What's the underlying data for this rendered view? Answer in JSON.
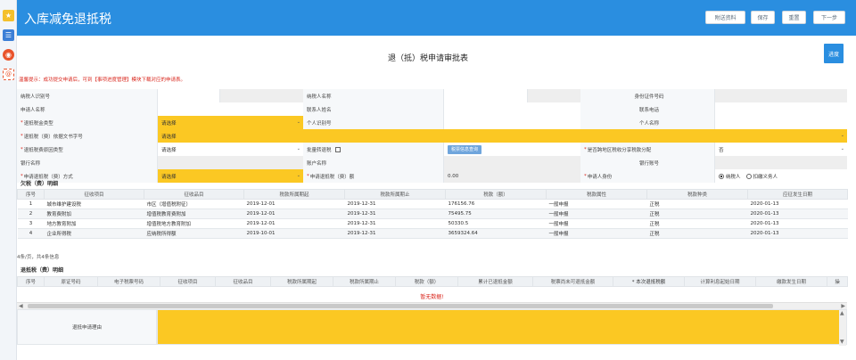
{
  "header": {
    "title": "入库减免退抵税",
    "buttons": {
      "docs": "附送资料",
      "save": "保存",
      "reset": "重置",
      "next": "下一步"
    }
  },
  "progress_button": "进度",
  "page_title": "退（抵）税申请审批表",
  "notice": "温馨提示：成功提交申请后，可到【事项进度管理】模块下载对应的申请表。",
  "form": {
    "row1": {
      "taxpayer_id_label": "纳税人识别号",
      "taxpayer_name_label": "纳税人名称",
      "id_number_label": "身份证件号码"
    },
    "row2": {
      "applicant_label": "申请人名称",
      "contact_label": "联系人姓名",
      "phone_label": "联系电话"
    },
    "row3": {
      "refund_type_label": "退抵税金类型",
      "refund_type_value": "请选择",
      "personal_id_label": "个人识别号",
      "personal_name_label": "个人名称"
    },
    "row4": {
      "doc_no_label": "退抵税（费）依据文书字号",
      "doc_no_value": "请选择"
    },
    "row5": {
      "reason_type_label": "退抵税费原因类型",
      "reason_type_value": "请选择",
      "batch_label": "批量转退税",
      "query_button": "税票信息查询",
      "cross_area_label": "是否跨地区税收分享税款分配",
      "cross_area_value": "否"
    },
    "row6": {
      "bank_name_label": "银行名称",
      "account_name_label": "账户名称",
      "bank_account_label": "银行账号"
    },
    "row7": {
      "method_label": "申请退抵税（费）方式",
      "method_value": "请选择",
      "amount_label": "申请退抵税（费）额",
      "amount_value": "0.00",
      "identity_label": "申请人身份",
      "identity_option_1": "纳税人",
      "identity_option_2": "扣缴义务人"
    }
  },
  "owed_section": {
    "title": "欠税（费）明细",
    "columns": [
      "序号",
      "征收项目",
      "征收品目",
      "税款所属期起",
      "税款所属期止",
      "税款（额）",
      "税款属性",
      "税款种类",
      "应征发生日期"
    ],
    "rows": [
      [
        "1",
        "城市维护建设税",
        "市区（增值税附征）",
        "2019-12-01",
        "2019-12-31",
        "176156.76",
        "一般申报",
        "正税",
        "2020-01-13"
      ],
      [
        "2",
        "教育费附加",
        "增值税教育费附加",
        "2019-12-01",
        "2019-12-31",
        "75495.75",
        "一般申报",
        "正税",
        "2020-01-13"
      ],
      [
        "3",
        "地方教育附加",
        "增值税地方教育附加",
        "2019-12-01",
        "2019-12-31",
        "50330.5",
        "一般申报",
        "正税",
        "2020-01-13"
      ],
      [
        "4",
        "企业所得税",
        "应纳税所得额",
        "2019-10-01",
        "2019-12-31",
        "3659324.64",
        "一般申报",
        "正税",
        "2020-01-13"
      ]
    ],
    "pager": "4条/页，共4条信息"
  },
  "refund_section": {
    "title": "退抵税（费）明细",
    "columns": [
      "序号",
      "原证号码",
      "电子税票号码",
      "征收项目",
      "征收品目",
      "税款所属期起",
      "税款所属期止",
      "税款（额）",
      "累计已退抵金额",
      "税票尚未可退抵金额",
      "* 本次退抵税额",
      "计算利息起始日期",
      "缴款发生日期",
      "操"
    ],
    "empty_message": "暂无数据!"
  },
  "reason": {
    "label": "退抵申请理由"
  },
  "colors": {
    "header_blue": "#2a8ee0",
    "required_yellow": "#fbc823",
    "error_red": "#d9261c"
  },
  "icons": [
    "star-icon",
    "list-icon",
    "eye-icon",
    "at-icon"
  ]
}
